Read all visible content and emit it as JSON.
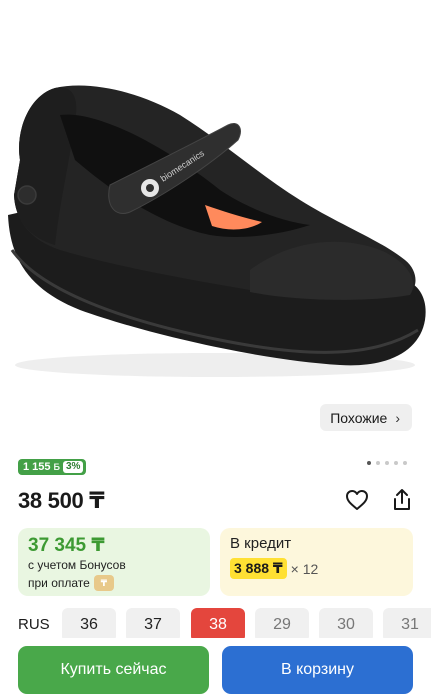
{
  "product": {
    "image_alt": "black leather mary jane school shoe",
    "logo_text": "biomecanics"
  },
  "similar": {
    "label": "Похожие",
    "icon": "chevron-right-icon"
  },
  "gallery": {
    "total_dots": 5,
    "active_dot": 1
  },
  "bonus_badge": {
    "amount": "1 155",
    "icon": "bonus-b-icon",
    "percent": "3%"
  },
  "price": {
    "value": "38 500 ₸"
  },
  "actions": {
    "favorite_icon": "heart-icon",
    "share_icon": "share-icon"
  },
  "bonus_card": {
    "price": "37 345 ₸",
    "line1": "с учетом Бонусов",
    "line2": "при оплате",
    "icon": "bonus-coin-icon"
  },
  "credit_card": {
    "title": "В кредит",
    "monthly": "3 888 ₸",
    "multiplier": "× 12"
  },
  "sizes": {
    "label": "RUS",
    "items": [
      {
        "value": "36",
        "state": "available"
      },
      {
        "value": "37",
        "state": "available"
      },
      {
        "value": "38",
        "state": "selected"
      },
      {
        "value": "29",
        "state": "sold-out"
      },
      {
        "value": "30",
        "state": "sold-out"
      },
      {
        "value": "31",
        "state": "sold-out"
      }
    ]
  },
  "buttons": {
    "buy_now": "Купить сейчас",
    "add_to_cart": "В корзину"
  },
  "colors": {
    "buy": "#49a84a",
    "cart": "#2c6fd2",
    "selected_size": "#e4463d",
    "credit_highlight": "#ffe033"
  }
}
